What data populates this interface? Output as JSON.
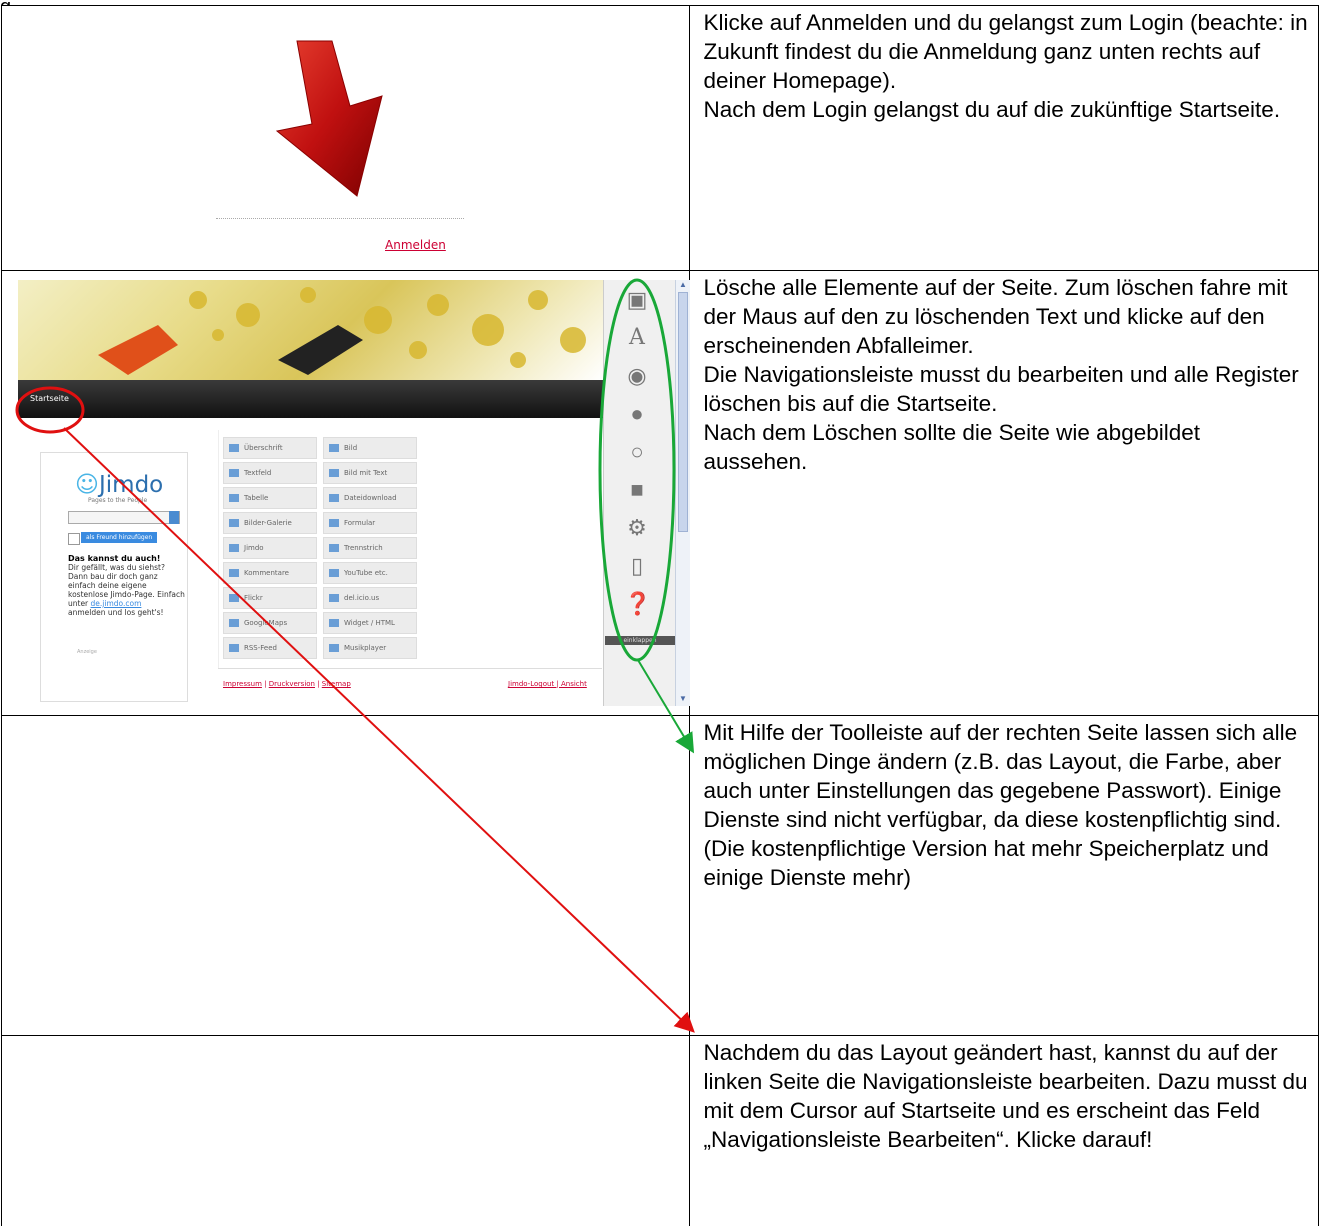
{
  "rows": [
    {
      "left": {
        "link_text": "Anmelden"
      },
      "right": {
        "p1": "Klicke auf Anmelden und du gelangst zum Login (beachte: in Zukunft findest du die Anmeldung ganz unten rechts auf deiner Homepage).",
        "p2": "Nach dem Login gelangst du auf die zukünftige Startseite."
      }
    },
    {
      "screenshot": {
        "nav_item": "Startseite",
        "logo": "Jimdo",
        "logo_tagline": "Pages to the People",
        "friend_button": "als Freund hinzufügen",
        "promo_title": "Das kannst du auch!",
        "promo_text": "Dir gefällt, was du siehst? Dann bau dir doch ganz einfach deine eigene kostenlose Jimdo-Page. Einfach unter",
        "promo_link": "de.jimdo.com",
        "promo_text2": "anmelden und los geht's!",
        "ad_label": "Anzeige",
        "buttons": [
          "Überschrift",
          "Bild",
          "Textfeld",
          "Bild mit Text",
          "Tabelle",
          "Dateidownload",
          "Bilder-Galerie",
          "Formular",
          "Jimdo",
          "Trennstrich",
          "Kommentare",
          "YouTube etc.",
          "Flickr",
          "del.icio.us",
          "GoogleMaps",
          "Widget / HTML",
          "RSS-Feed",
          "Musikplayer"
        ],
        "footer_left": [
          "Impressum",
          "Druckversion",
          "Sitemap"
        ],
        "footer_right": "Jimdo-Logout | Ansicht",
        "collapse_label": "einklappen",
        "tools": [
          "layout-icon",
          "font-icon",
          "sound-icon",
          "users-icon",
          "chat-icon",
          "box-icon",
          "settings-icon",
          "stats-icon",
          "help-icon"
        ]
      },
      "right": {
        "p1": "Lösche alle Elemente auf der Seite. Zum löschen fahre mit der Maus auf den zu löschenden Text und klicke auf den erscheinenden Abfalleimer.",
        "p2": "Die Navigationsleiste musst du bearbeiten und alle Register löschen bis auf die Startseite.",
        "p3": "Nach dem Löschen sollte die Seite wie abgebildet aussehen."
      }
    },
    {
      "right": {
        "p1": "Mit Hilfe der Toolleiste auf der rechten Seite lassen sich alle möglichen Dinge ändern (z.B. das Layout, die Farbe, aber auch unter Einstellungen das gegebene Passwort). Einige Dienste sind nicht verfügbar, da diese kostenpflichtig sind. (Die kostenpflichtige Version hat mehr Speicherplatz und einige Dienste mehr)"
      }
    },
    {
      "right": {
        "p1": "Nachdem du das Layout geändert hast, kannst du auf der linken Seite die Navigationsleiste bearbeiten. Dazu musst du mit dem Cursor auf Startseite und es erscheint das Feld „Navigationsleiste Bearbeiten“. Klicke darauf!"
      }
    }
  ],
  "colors": {
    "annotation_red": "#e01010",
    "annotation_green": "#19a838",
    "link_red": "#cc0033"
  }
}
